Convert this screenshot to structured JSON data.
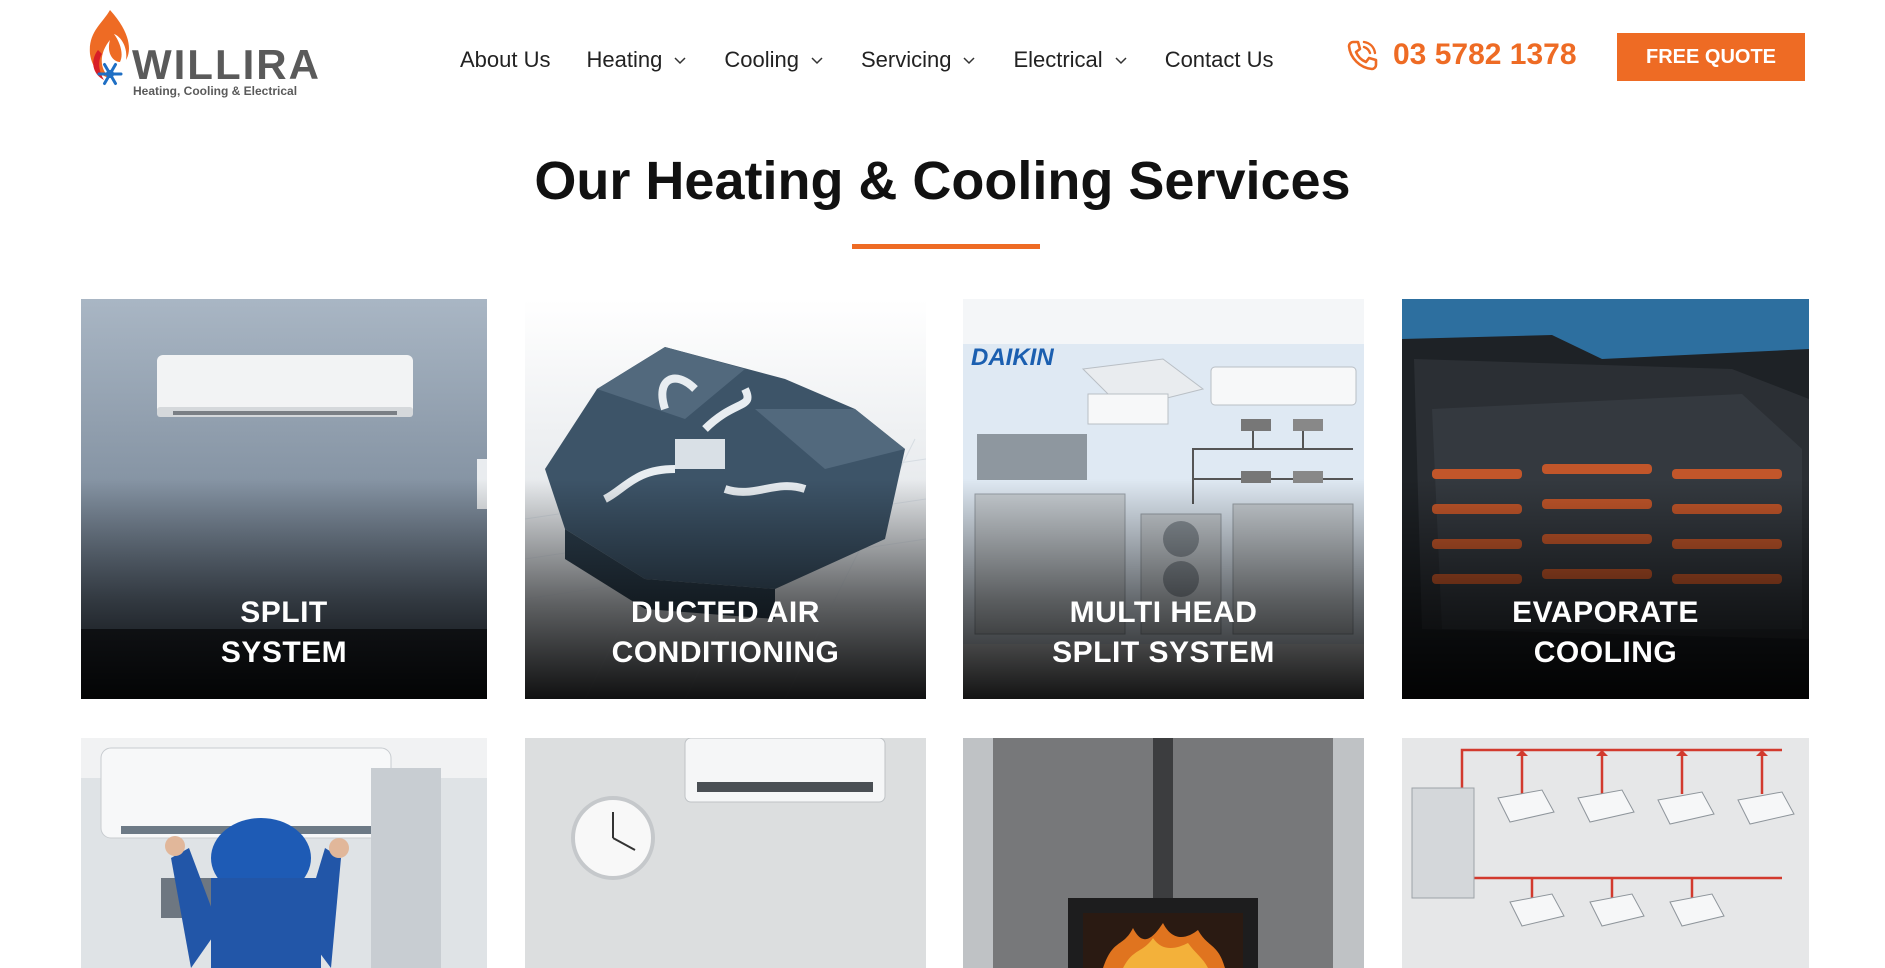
{
  "header": {
    "logo": {
      "name": "WILLIRA",
      "tagline": "Heating, Cooling & Electrical"
    },
    "nav": [
      {
        "label": "About Us",
        "dropdown": false
      },
      {
        "label": "Heating",
        "dropdown": true
      },
      {
        "label": "Cooling",
        "dropdown": true
      },
      {
        "label": "Servicing",
        "dropdown": true
      },
      {
        "label": "Electrical",
        "dropdown": true
      },
      {
        "label": "Contact Us",
        "dropdown": false
      }
    ],
    "phone": {
      "icon": "phone-icon",
      "number": "03 5782 1378"
    },
    "cta": {
      "label": "FREE QUOTE"
    }
  },
  "section": {
    "title": "Our Heating & Cooling Services"
  },
  "cards": [
    {
      "line1": "SPLIT",
      "line2": "SYSTEM",
      "image": "wall-mounted-split-system-unit"
    },
    {
      "line1": "DUCTED AIR",
      "line2": "CONDITIONING",
      "image": "house-cutaway-ducting"
    },
    {
      "line1": "MULTI HEAD",
      "line2": "SPLIT SYSTEM",
      "image": "daikin-multi-head-units",
      "brand_text": "DAIKIN"
    },
    {
      "line1": "EVAPORATE",
      "line2": "COOLING",
      "image": "rooftop-evaporative-cooler"
    },
    {
      "line1": "",
      "line2": "",
      "image": "technician-servicing-split-system"
    },
    {
      "line1": "",
      "line2": "",
      "image": "wall-unit-and-clock"
    },
    {
      "line1": "",
      "line2": "",
      "image": "wood-heater-fireplace"
    },
    {
      "line1": "",
      "line2": "",
      "image": "vrf-ceiling-cassette-diagram"
    }
  ],
  "colors": {
    "accent": "#ee6b24",
    "text": "#111111",
    "nav_text": "#222222",
    "logo_grey": "#5a5a5a"
  }
}
